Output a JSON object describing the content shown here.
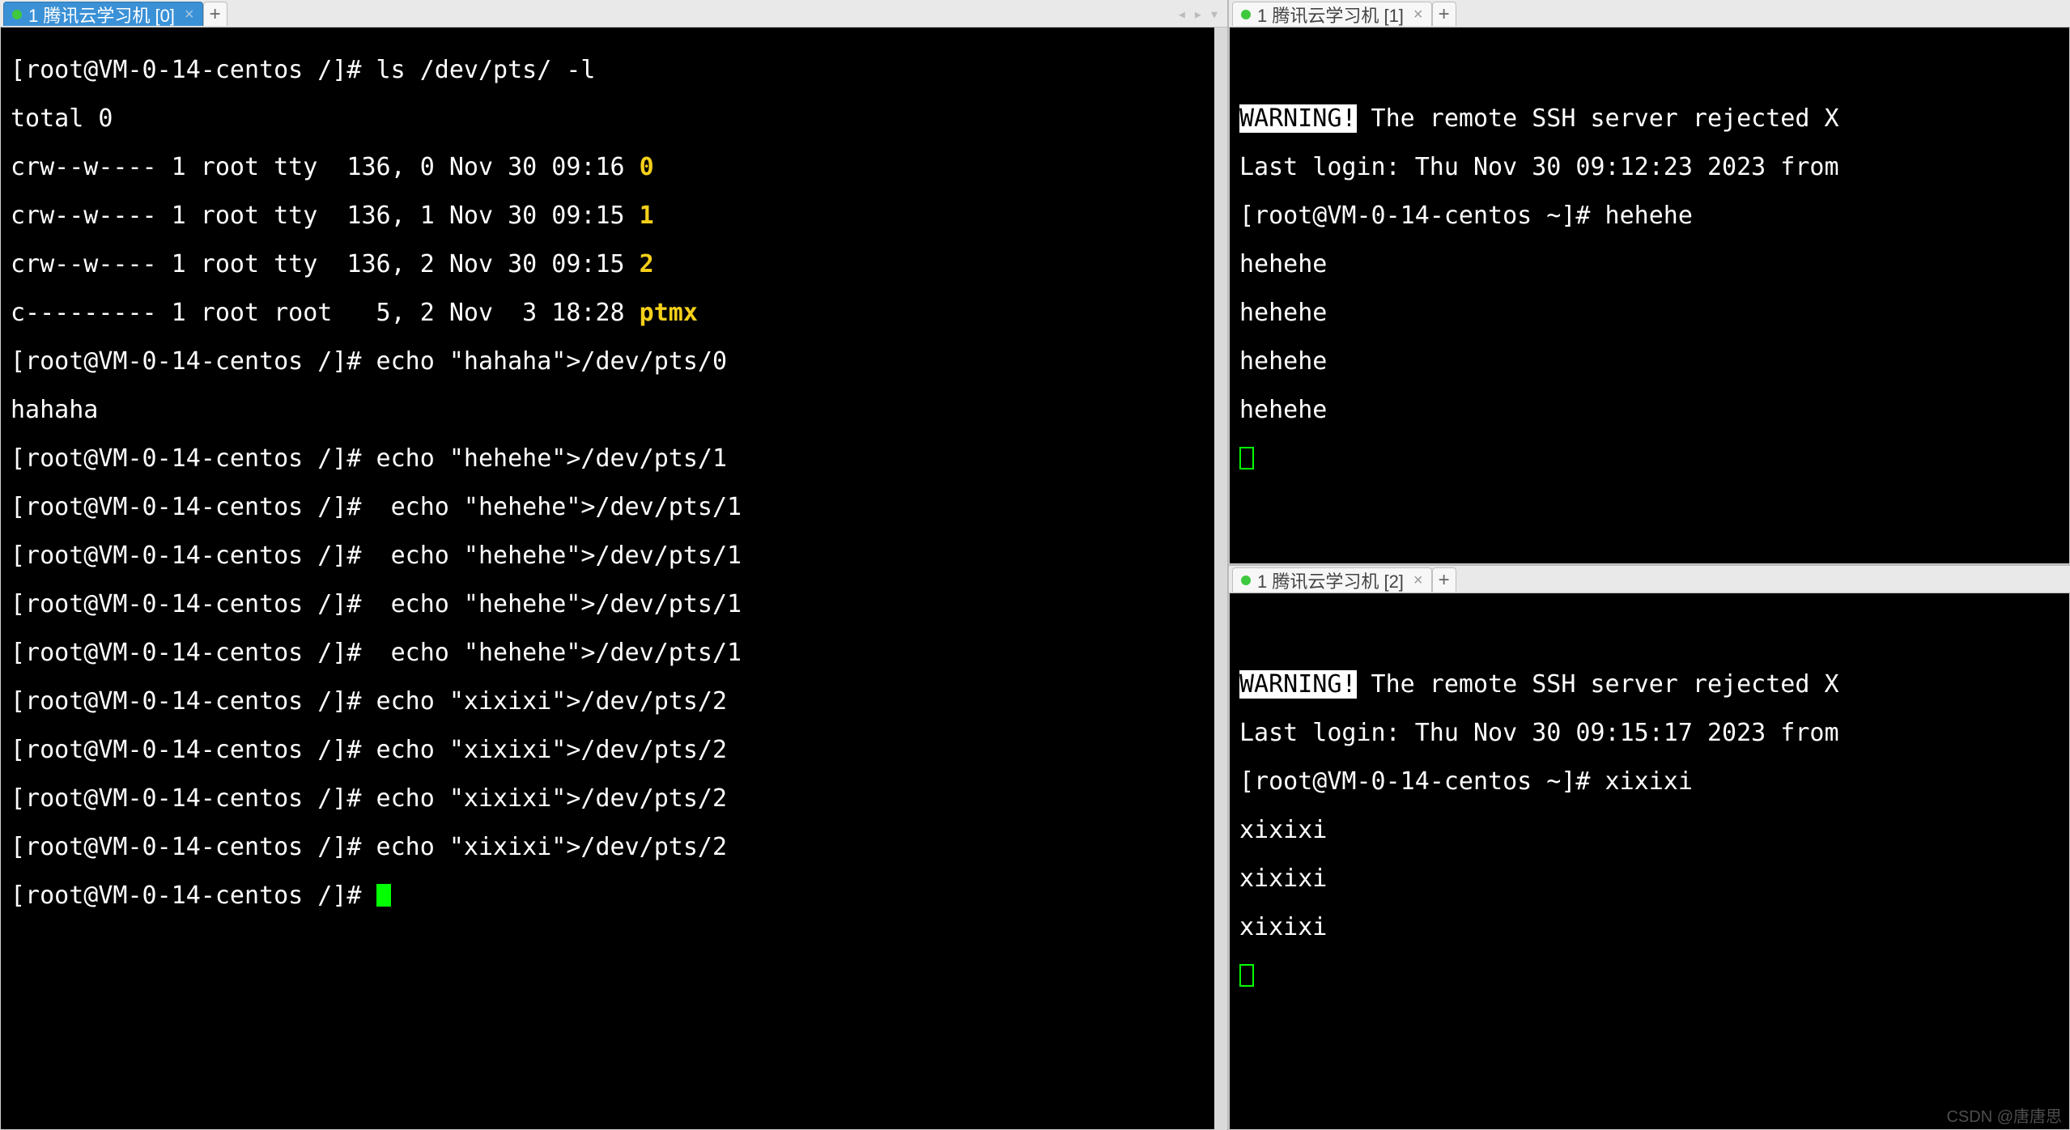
{
  "left": {
    "tab": {
      "label": "1 腾讯云学习机 [0]"
    },
    "prompt": "[root@VM-0-14-centos /]# ",
    "cmd_ls": "ls /dev/pts/ -l",
    "ls_total": "total 0",
    "ls_rows": [
      {
        "perm": "crw--w---- 1 root tty  136, 0 Nov 30 09:16 ",
        "name": "0"
      },
      {
        "perm": "crw--w---- 1 root tty  136, 1 Nov 30 09:15 ",
        "name": "1"
      },
      {
        "perm": "crw--w---- 1 root tty  136, 2 Nov 30 09:15 ",
        "name": "2"
      },
      {
        "perm": "c--------- 1 root root   5, 2 Nov  3 18:28 ",
        "name": "ptmx"
      }
    ],
    "cmd_hahaha": "echo \"hahaha\">/dev/pts/0",
    "out_hahaha": "hahaha",
    "cmd_hehehe0": "echo \"hehehe\">/dev/pts/1",
    "cmd_hehehe1": " echo \"hehehe\">/dev/pts/1",
    "cmd_hehehe2": " echo \"hehehe\">/dev/pts/1",
    "cmd_hehehe3": " echo \"hehehe\">/dev/pts/1",
    "cmd_hehehe4": " echo \"hehehe\">/dev/pts/1",
    "cmd_xixixi0": "echo \"xixixi\">/dev/pts/2",
    "cmd_xixixi1": "echo \"xixixi\">/dev/pts/2",
    "cmd_xixixi2": "echo \"xixixi\">/dev/pts/2",
    "cmd_xixixi3": "echo \"xixixi\">/dev/pts/2"
  },
  "right_top": {
    "tab": {
      "label": "1 腾讯云学习机 [1]"
    },
    "warn_label": "WARNING!",
    "warn_rest": " The remote SSH server rejected X",
    "lastlogin": "Last login: Thu Nov 30 09:12:23 2023 from",
    "prompt": "[root@VM-0-14-centos ~]# ",
    "cmd": "hehehe",
    "out0": "hehehe",
    "out1": "hehehe",
    "out2": "hehehe",
    "out3": "hehehe"
  },
  "right_bottom": {
    "tab": {
      "label": "1 腾讯云学习机 [2]"
    },
    "warn_label": "WARNING!",
    "warn_rest": " The remote SSH server rejected X",
    "lastlogin": "Last login: Thu Nov 30 09:15:17 2023 from",
    "prompt": "[root@VM-0-14-centos ~]# ",
    "cmd": "xixixi",
    "out0": "xixixi",
    "out1": "xixixi",
    "out2": "xixixi"
  },
  "watermark": "CSDN @唐唐思"
}
